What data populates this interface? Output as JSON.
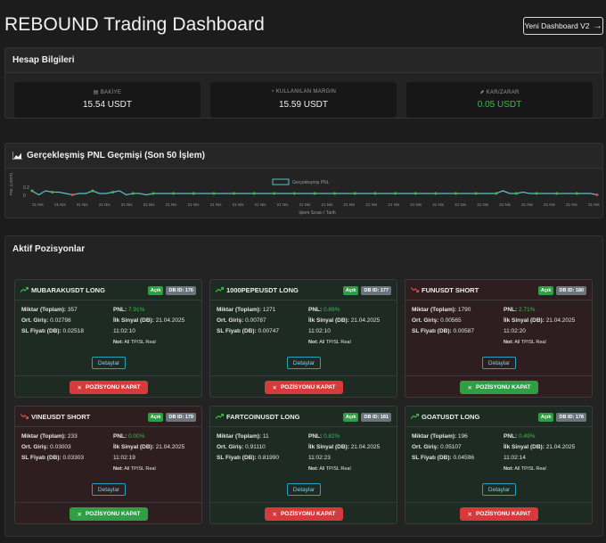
{
  "header": {
    "title": "REBOUND Trading Dashboard",
    "v2_button": "Yeni Dashboard V2"
  },
  "account": {
    "title": "Hesap Bilgileri",
    "boxes": [
      {
        "label": "BAKİYE",
        "value": "15.54 USDT",
        "icon": "wallet-icon"
      },
      {
        "label": "KULLANILAN MARGIN",
        "value": "15.59 USDT",
        "icon": "chart-pie-icon"
      },
      {
        "label": "KAR/ZARAR",
        "value": "0.05 USDT",
        "icon": "trend-icon",
        "color": "#3fb950"
      }
    ]
  },
  "pnl": {
    "title": "Gerçekleşmiş PNL Geçmişi (Son 50 İşlem)",
    "chart_data": {
      "type": "line",
      "series": [
        {
          "name": "Gerçekleşmiş PNL",
          "values": [
            0.1,
            -0.05,
            0.1,
            0.05,
            0.05,
            0.0,
            -0.05,
            0.0,
            0.0,
            0.1,
            0.0,
            0.0,
            0.05,
            0.1,
            -0.05,
            0.0,
            0.0,
            -0.05,
            0.0,
            0.0,
            0.0,
            0.0,
            0.0,
            0.0,
            0.0,
            0.0,
            0.0,
            0.0,
            0.0,
            0.0,
            0.0,
            0.0,
            0.0,
            0.0,
            0.0,
            0.0,
            0.0,
            0.0,
            0.0,
            0.0,
            0.0,
            0.0,
            0.0,
            0.0,
            0.0,
            0.0,
            0.0,
            0.0,
            0.0,
            0.0,
            0.0,
            0.0,
            0.0,
            0.0,
            0.0,
            0.0,
            0.0,
            0.0,
            0.0,
            0.0,
            0.0,
            0.0,
            0.0,
            0.0,
            0.0,
            0.0,
            0.0,
            0.0,
            0.0,
            0.0,
            0.1,
            0.0,
            0.0,
            0.05,
            0.0,
            0.0,
            0.0,
            0.0,
            0.0,
            0.0,
            0.0,
            0.0,
            0.0,
            0.0,
            -0.05
          ],
          "color": "#5bc0c0"
        }
      ],
      "x_tick_label": "21 Nis",
      "x_tick_count": 26,
      "xlabel": "İşlem Sırası / Tarih",
      "ylabel": "PNL (USDT)",
      "yticks": [
        "0.2",
        "0"
      ],
      "ylim": [
        -0.1,
        0.2
      ],
      "legend": "top-center"
    }
  },
  "positions": {
    "title": "Aktif Pozisyonlar",
    "labels": {
      "qty": "Miktar (Toplam):",
      "entry": "Ort. Giriş:",
      "sl": "SL Fiyatı (DB):",
      "pnl": "PNL:",
      "first_signal": "İlk Sinyal (DB):",
      "note": "Not:",
      "details": "Detaylar",
      "close": "POZİSYONU KAPAT",
      "open": "Açık"
    },
    "items": [
      {
        "symbol": "MUBARAKUSDT LONG",
        "side": "long",
        "db": "DB ID: 176",
        "qty": "357",
        "entry": "0.02798",
        "sl": "0.02518",
        "pnl": "7.91%",
        "signal_date": "21.04.2025",
        "signal_time": "11:02:10",
        "note": "All TP/SL Real",
        "close_color": "red"
      },
      {
        "symbol": "1000PEPEUSDT LONG",
        "side": "long",
        "db": "DB ID: 177",
        "qty": "1271",
        "entry": "0.00787",
        "sl": "0.00747",
        "pnl": "0.89%",
        "signal_date": "21.04.2025",
        "signal_time": "11:02:10",
        "note": "All TP/SL Real",
        "close_color": "red"
      },
      {
        "symbol": "FUNUSDT SHORT",
        "side": "short",
        "db": "DB ID: 180",
        "qty": "1790",
        "entry": "0.00565",
        "sl": "0.00587",
        "pnl": "2.71%",
        "signal_date": "21.04.2025",
        "signal_time": "11:02:20",
        "note": "All TP/SL Real",
        "close_color": "green"
      },
      {
        "symbol": "VINEUSDT SHORT",
        "side": "short",
        "db": "DB ID: 179",
        "qty": "233",
        "entry": "0.03003",
        "sl": "0.03303",
        "pnl": "0.00%",
        "signal_date": "21.04.2025",
        "signal_time": "11:02:19",
        "note": "All TP/SL Real",
        "close_color": "green"
      },
      {
        "symbol": "FARTCOINUSDT LONG",
        "side": "long",
        "db": "DB ID: 181",
        "qty": "11",
        "entry": "0.91110",
        "sl": "0.81990",
        "pnl": "0.82%",
        "signal_date": "21.04.2025",
        "signal_time": "11:02:23",
        "note": "All TP/SL Real",
        "close_color": "red"
      },
      {
        "symbol": "GOATUSDT LONG",
        "side": "long",
        "db": "DB ID: 178",
        "qty": "196",
        "entry": "0.05107",
        "sl": "0.04596",
        "pnl": "0.49%",
        "signal_date": "21.04.2025",
        "signal_time": "11:02:14",
        "note": "All TP/SL Real",
        "close_color": "red"
      }
    ]
  }
}
